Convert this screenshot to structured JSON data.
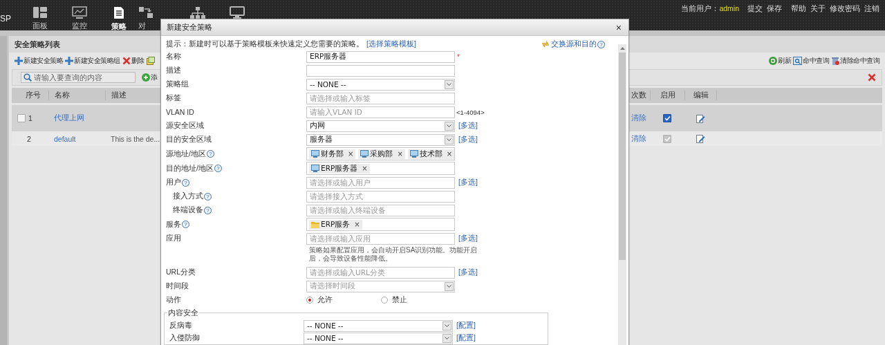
{
  "topbar": {
    "brand": "SP",
    "nav": [
      {
        "label": "面板",
        "selected": false
      },
      {
        "label": "监控",
        "selected": false
      },
      {
        "label": "策略",
        "selected": true
      },
      {
        "label": "对",
        "selected": false
      },
      {
        "selected": false
      },
      {
        "selected": false
      }
    ],
    "user_label": "当前用户：",
    "user": "admin",
    "link_groups": [
      [
        "提交",
        "保存"
      ],
      [
        "帮助",
        "关于",
        "修改密码",
        "注销"
      ]
    ]
  },
  "panel": {
    "title": "安全策略列表",
    "toolbar": [
      {
        "kind": "add",
        "label": "新建安全策略"
      },
      {
        "kind": "add",
        "label": "新建安全策略组"
      },
      {
        "kind": "delete",
        "label": "删除"
      },
      {
        "kind": "copy"
      }
    ],
    "toolbar_right": [
      {
        "kind": "refresh",
        "label": "刷新"
      },
      {
        "kind": "query",
        "label": "命中查询"
      },
      {
        "kind": "clear",
        "label": "清除命中查询"
      }
    ],
    "search": {
      "placeholder": "请输入要查询的内容"
    },
    "add_button": "添",
    "table": {
      "columns": [
        "序号",
        "名称",
        "描述",
        "次数",
        "启用",
        "编辑"
      ],
      "rows": [
        {
          "highlighted": true,
          "select_box": {
            "checked": false
          },
          "index": "1",
          "name": "代理上网",
          "clear": "清除",
          "enabled": {
            "checked": true,
            "disabled": false
          }
        },
        {
          "highlighted": false,
          "index": "2",
          "name": "default",
          "description": "This is the de...",
          "clear": "清除",
          "enabled": {
            "checked": true,
            "disabled": true
          }
        }
      ]
    }
  },
  "dialog": {
    "title": "新建安全策略",
    "close": "×",
    "hint": "提示：新建时可以基于策略模板来快速定义您需要的策略。",
    "hint_link": "[选择策略模板]",
    "swap_link": "交换源和目的",
    "swap_help": "?",
    "fields": [
      {
        "kind": "text",
        "label": "名称",
        "value": "ERP服务器",
        "required_mark": "*"
      },
      {
        "kind": "text",
        "label": "描述"
      },
      {
        "kind": "select",
        "label": "策略组",
        "value": "-- NONE --"
      },
      {
        "kind": "text",
        "label": "标签",
        "placeholder": "请选择或输入标签"
      },
      {
        "kind": "text",
        "label": "VLAN ID",
        "placeholder": "请输入VLAN ID",
        "suffix": "<1-4094>"
      },
      {
        "kind": "select",
        "label": "源安全区域",
        "value": "内网",
        "link": "[多选]"
      },
      {
        "kind": "select",
        "label": "目的安全区域",
        "value": "服务器",
        "link": "[多选]"
      },
      {
        "kind": "tags",
        "label": "源地址/地区",
        "help": "?",
        "tags": [
          {
            "kind": "host",
            "text": "财务部",
            "remove": "×"
          },
          {
            "kind": "host",
            "text": "采购部",
            "remove": "×"
          },
          {
            "kind": "host",
            "text": "技术部",
            "remove": "×"
          }
        ]
      },
      {
        "kind": "tags",
        "label": "目的地址/地区",
        "help": "?",
        "tags": [
          {
            "kind": "host",
            "text": "ERP服务器",
            "remove": "×"
          }
        ]
      },
      {
        "kind": "text",
        "label": "用户",
        "help": "?",
        "placeholder": "请选择或输入用户",
        "link": "[多选]",
        "children": [
          {
            "kind": "text",
            "label": "接入方式",
            "help": "?",
            "placeholder": "请选择接入方式"
          },
          {
            "kind": "text",
            "label": "终端设备",
            "help": "?",
            "placeholder": "请选择或输入终端设备"
          }
        ]
      },
      {
        "kind": "tags",
        "label": "服务",
        "help": "?",
        "tags": [
          {
            "kind": "service",
            "text": "ERP服务",
            "remove": "×"
          }
        ]
      },
      {
        "kind": "text",
        "label": "应用",
        "placeholder": "请选择或输入应用",
        "link": "[多选]"
      },
      {
        "kind": "note",
        "text": "策略如果配置应用，会自动开启SA识别功能。功能开启后，会导致设备性能降低。"
      },
      {
        "kind": "text",
        "label": "URL分类",
        "placeholder": "请选择或输入URL分类",
        "link": "[多选]"
      },
      {
        "kind": "select",
        "label": "时间段",
        "placeholder": "请选择时间段"
      },
      {
        "kind": "radio",
        "label": "动作",
        "options": [
          {
            "label": "允许",
            "selected": true
          },
          {
            "label": "禁止",
            "selected": false
          }
        ]
      }
    ],
    "fieldset": {
      "legend": "内容安全",
      "fields": [
        {
          "kind": "select",
          "label": "反病毒",
          "value": "-- NONE --",
          "link": "[配置]"
        },
        {
          "kind": "select",
          "label": "入侵防御",
          "value": "-- NONE --",
          "link": "[配置]"
        }
      ]
    }
  }
}
